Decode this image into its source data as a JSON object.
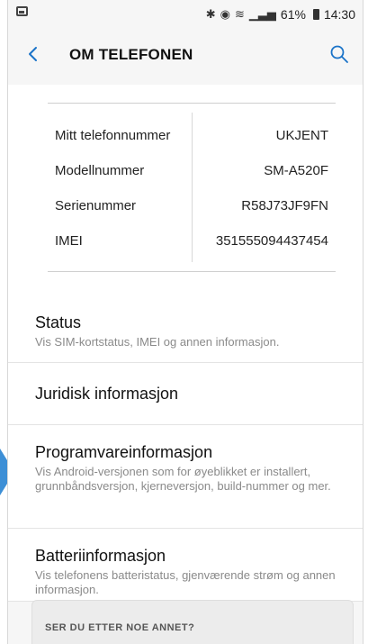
{
  "statusbar": {
    "battery_percent": "61%",
    "time": "14:30",
    "icons": [
      "image-icon",
      "bluetooth-icon",
      "mute-icon",
      "wifi-icon",
      "signal-icon",
      "battery-icon"
    ]
  },
  "header": {
    "title": "OM TELEFONEN"
  },
  "info": {
    "rows": [
      {
        "label": "Mitt telefonnummer",
        "value": "UKJENT"
      },
      {
        "label": "Modellnummer",
        "value": "SM-A520F"
      },
      {
        "label": "Serienummer",
        "value": "R58J73JF9FN"
      },
      {
        "label": "IMEI",
        "value": "351555094437454"
      }
    ]
  },
  "list": {
    "items": [
      {
        "title": "Status",
        "subtitle": "Vis SIM-kortstatus, IMEI og annen informasjon."
      },
      {
        "title": "Juridisk informasjon",
        "subtitle": ""
      },
      {
        "title": "Programvareinformasjon",
        "subtitle": "Vis Android-versjonen som for øyeblikket er installert, grunnbåndsversjon, kjerneversjon, build-nummer og mer."
      },
      {
        "title": "Batteriinformasjon",
        "subtitle": "Vis telefonens batteristatus, gjenværende strøm og annen informasjon."
      }
    ]
  },
  "bottom_card": {
    "text": "SER DU ETTER NOE ANNET?"
  },
  "colors": {
    "accent": "#1a73c8",
    "arrow": "#3d8fd6"
  }
}
